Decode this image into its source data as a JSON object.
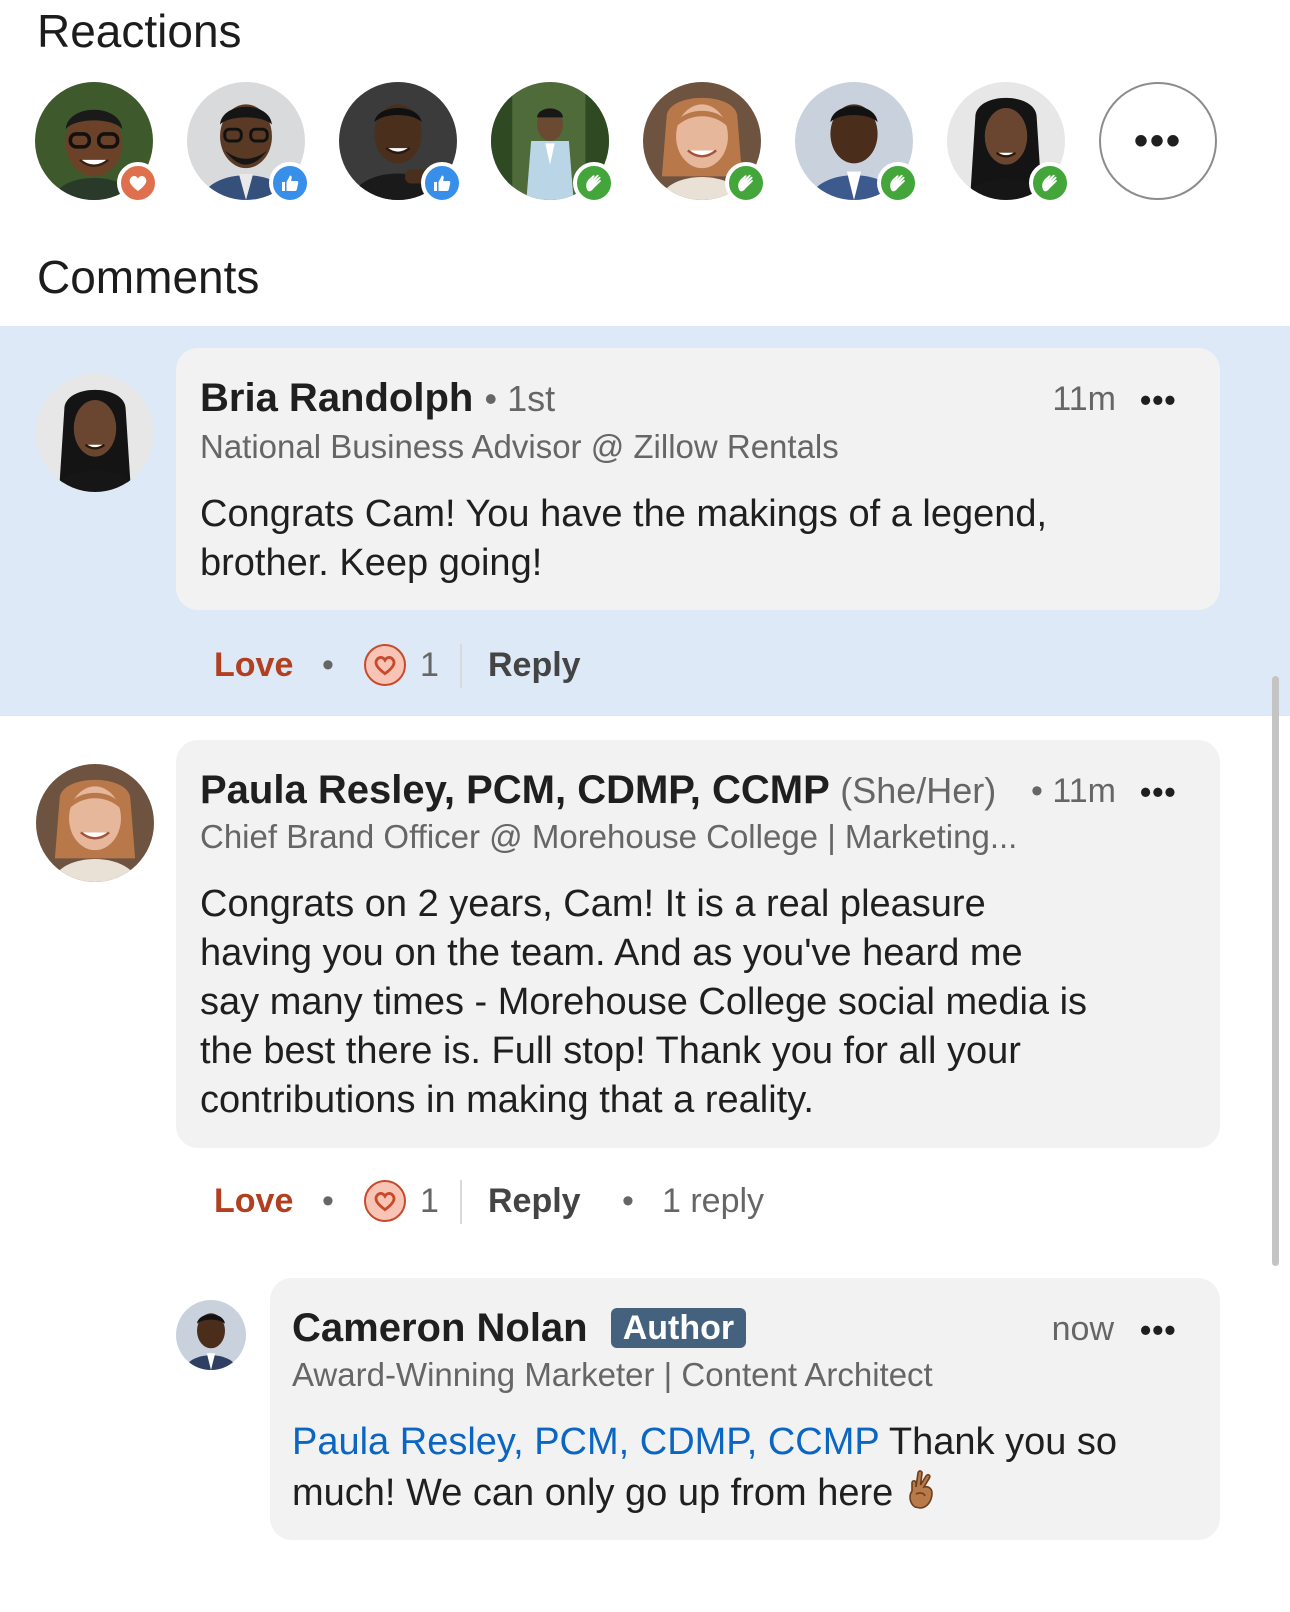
{
  "reactions_section": {
    "title": "Reactions",
    "reactors": [
      {
        "reaction": "love",
        "skin": "#6b4228",
        "hair": "#1a1a1a",
        "bg": "#3e5a2c",
        "shirt": "#2a3a2a"
      },
      {
        "reaction": "like",
        "skin": "#5a3a24",
        "hair": "#151515",
        "bg": "#d8dadc",
        "shirt": "#35507a"
      },
      {
        "reaction": "like",
        "skin": "#4a2f1d",
        "hair": "#101010",
        "bg": "#3b3b3b",
        "shirt": "#1a1a1a"
      },
      {
        "reaction": "celebrate",
        "skin": "#6a4a30",
        "hair": "#181818",
        "bg": "#4f6b3a",
        "shirt": "#b9d5e6"
      },
      {
        "reaction": "celebrate",
        "skin": "#e6b79a",
        "hair": "#b9784a",
        "bg": "#6e5340",
        "shirt": "#e9e0d6"
      },
      {
        "reaction": "celebrate",
        "skin": "#4b2d1c",
        "hair": "#121212",
        "bg": "#c9d2dc",
        "shirt": "#3c5a8e"
      },
      {
        "reaction": "celebrate",
        "skin": "#6a4530",
        "hair": "#141414",
        "bg": "#e7e7e7",
        "shirt": "#161616"
      }
    ],
    "more_label": "•••"
  },
  "comments_section": {
    "title": "Comments",
    "comments": [
      {
        "name": "Bria Randolph",
        "degree": "• 1st",
        "time": "11m",
        "menu": "•••",
        "headline": "National Business Advisor @ Zillow Rentals",
        "text_lines": [
          "Congrats Cam! You have the makings of a legend,",
          "brother. Keep going!"
        ],
        "reaction_label": "Love",
        "separator": "•",
        "reaction_count": "1",
        "reply_label": "Reply"
      },
      {
        "name": "Paula Resley, PCM, CDMP, CCMP",
        "pronouns": "(She/Her)",
        "time": "• 11m",
        "menu": "•••",
        "headline": "Chief Brand Officer @ Morehouse College | Marketing...",
        "text_lines": [
          "Congrats on 2 years, Cam!  It is a real pleasure",
          "having you on the team.  And as you've heard me",
          "say many times - Morehouse College social media is",
          "the best there is.  Full stop!  Thank you for all your",
          "contributions in making that a reality."
        ],
        "reaction_label": "Love",
        "separator": "•",
        "reaction_count": "1",
        "reply_label": "Reply",
        "reply_separator": "•",
        "replies_label": "1 reply"
      }
    ],
    "reply": {
      "name": "Cameron Nolan",
      "badge": "Author",
      "time": "now",
      "menu": "•••",
      "headline": "Award-Winning Marketer | Content Architect",
      "mention": "Paula Resley, PCM, CDMP, CCMP",
      "text_after_mention": " Thank you so",
      "text_line2": "much! We can only go up from here"
    }
  },
  "colors": {
    "highlight_bg": "#dde9f7",
    "bubble_bg": "#f2f2f2",
    "love_red": "#b24020",
    "mention_blue": "#0a66c2",
    "author_badge_bg": "#44617d"
  }
}
